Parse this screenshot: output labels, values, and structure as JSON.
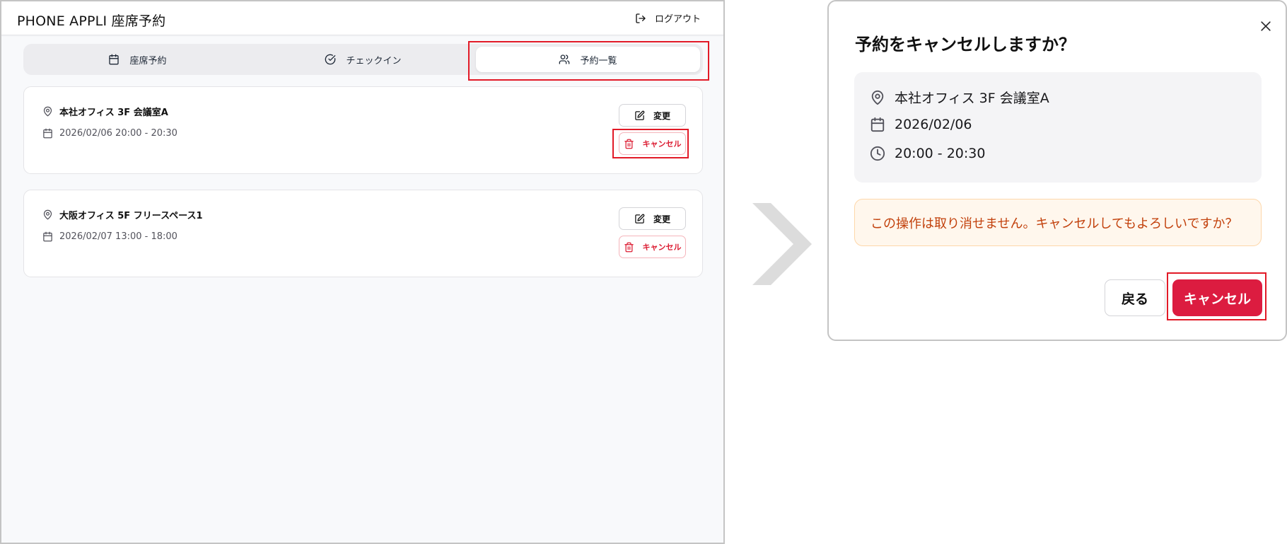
{
  "colors": {
    "highlight": "#e21a27",
    "danger": "#dc1c32",
    "confirm_bg": "#dc1c40",
    "warning_text": "#c2410c",
    "warning_bg": "#fff7ed"
  },
  "header": {
    "title": "PHONE APPLI 座席予約",
    "logout_label": "ログアウト",
    "logout_icon": "logout-icon"
  },
  "tabs": [
    {
      "label": "座席予約",
      "icon": "calendar-icon"
    },
    {
      "label": "チェックイン",
      "icon": "check-circle-icon"
    },
    {
      "label": "予約一覧",
      "icon": "users-icon",
      "active": true
    }
  ],
  "reservations": [
    {
      "location": "本社オフィス 3F 会議室A",
      "datetime": "2026/02/06 20:00 - 20:30",
      "edit_label": "変更",
      "cancel_label": "キャンセル"
    },
    {
      "location": "大阪オフィス 5F フリースペース1",
      "datetime": "2026/02/07 13:00 - 18:00",
      "edit_label": "変更",
      "cancel_label": "キャンセル"
    }
  ],
  "dialog": {
    "title": "予約をキャンセルしますか？",
    "location": "本社オフィス 3F 会議室A",
    "date": "2026/02/06",
    "time": "20:00 - 20:30",
    "warning": "この操作は取り消せません。キャンセルしてもよろしいですか？",
    "back_label": "戻る",
    "confirm_label": "キャンセル"
  }
}
